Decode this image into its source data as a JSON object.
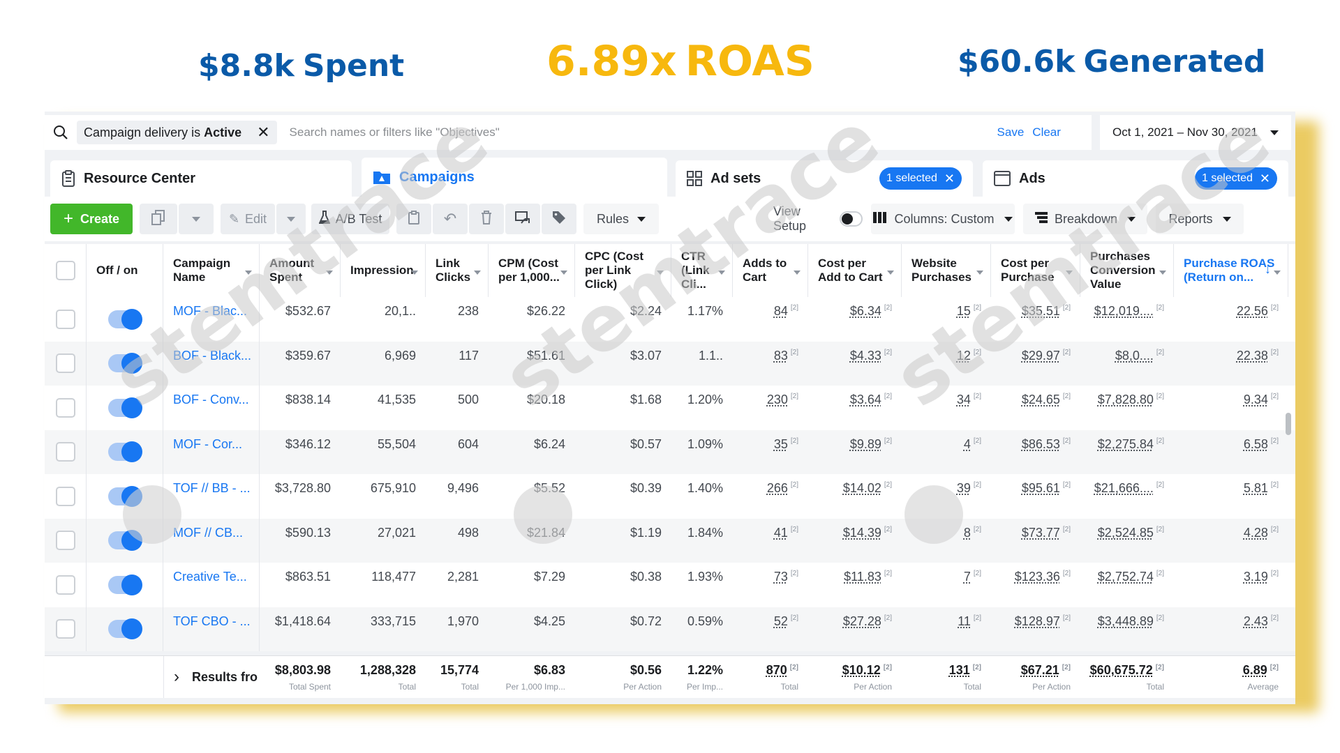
{
  "stats": {
    "spent_value": "$8.8k",
    "spent_label": "Spent",
    "roas_value": "6.89x",
    "roas_label": "ROAS",
    "generated_value": "$60.6k",
    "generated_label": "Generated"
  },
  "filter": {
    "chip_prefix": "Campaign delivery is",
    "chip_value": "Active",
    "placeholder": "Search names or filters like \"Objectives\"",
    "save": "Save",
    "clear": "Clear",
    "date_range": "Oct 1, 2021 – Nov 30, 2021"
  },
  "tabs": {
    "resource": "Resource Center",
    "campaigns": "Campaigns",
    "adsets": "Ad sets",
    "adsets_badge": "1 selected",
    "ads": "Ads",
    "ads_badge": "1 selected"
  },
  "toolbar": {
    "create": "Create",
    "edit": "Edit",
    "ab_test": "A/B Test",
    "rules": "Rules",
    "view_setup": "View Setup",
    "columns": "Columns: Custom",
    "breakdown": "Breakdown",
    "reports": "Reports"
  },
  "columns": [
    {
      "key": "toggle",
      "label": "Off / on"
    },
    {
      "key": "name",
      "label": "Campaign Name"
    },
    {
      "key": "spent",
      "label": "Amount Spent"
    },
    {
      "key": "impr",
      "label": "Impression"
    },
    {
      "key": "clicks",
      "label": "Link Clicks"
    },
    {
      "key": "cpm",
      "label": "CPM (Cost per 1,000..."
    },
    {
      "key": "cpc",
      "label": "CPC (Cost per Link Click)"
    },
    {
      "key": "ctr",
      "label": "CTR (Link Cli..."
    },
    {
      "key": "atc",
      "label": "Adds to Cart"
    },
    {
      "key": "cpatc",
      "label": "Cost per Add to Cart"
    },
    {
      "key": "wp",
      "label": "Website Purchases"
    },
    {
      "key": "cpp",
      "label": "Cost per Purchase"
    },
    {
      "key": "pcv",
      "label": "Purchases Conversion Value"
    },
    {
      "key": "roas",
      "label": "Purchase ROAS (Return on..."
    }
  ],
  "rows": [
    {
      "name": "MOF - Blac...",
      "spent": "$532.67",
      "impr": "20,1..",
      "clicks": "238",
      "cpm": "$26.22",
      "cpc": "$2.24",
      "ctr": "1.17%",
      "atc": "84",
      "cpatc": "$6.34",
      "wp": "15",
      "cpp": "$35.51",
      "pcv": "$12,019....",
      "roas": "22.56"
    },
    {
      "name": "BOF - Black...",
      "spent": "$359.67",
      "impr": "6,969",
      "clicks": "117",
      "cpm": "$51.61",
      "cpc": "$3.07",
      "ctr": "1.1..",
      "atc": "83",
      "cpatc": "$4.33",
      "wp": "12",
      "cpp": "$29.97",
      "pcv": "$8,0....",
      "roas": "22.38"
    },
    {
      "name": "BOF - Conv...",
      "spent": "$838.14",
      "impr": "41,535",
      "clicks": "500",
      "cpm": "$20.18",
      "cpc": "$1.68",
      "ctr": "1.20%",
      "atc": "230",
      "cpatc": "$3.64",
      "wp": "34",
      "cpp": "$24.65",
      "pcv": "$7,828.80",
      "roas": "9.34"
    },
    {
      "name": "MOF - Cor...",
      "spent": "$346.12",
      "impr": "55,504",
      "clicks": "604",
      "cpm": "$6.24",
      "cpc": "$0.57",
      "ctr": "1.09%",
      "atc": "35",
      "cpatc": "$9.89",
      "wp": "4",
      "cpp": "$86.53",
      "pcv": "$2,275.84",
      "roas": "6.58"
    },
    {
      "name": "TOF // BB - ...",
      "spent": "$3,728.80",
      "impr": "675,910",
      "clicks": "9,496",
      "cpm": "$5.52",
      "cpc": "$0.39",
      "ctr": "1.40%",
      "atc": "266",
      "cpatc": "$14.02",
      "wp": "39",
      "cpp": "$95.61",
      "pcv": "$21,666....",
      "roas": "5.81"
    },
    {
      "name": "MOF // CB...",
      "spent": "$590.13",
      "impr": "27,021",
      "clicks": "498",
      "cpm": "$21.84",
      "cpc": "$1.19",
      "ctr": "1.84%",
      "atc": "41",
      "cpatc": "$14.39",
      "wp": "8",
      "cpp": "$73.77",
      "pcv": "$2,524.85",
      "roas": "4.28"
    },
    {
      "name": "Creative Te...",
      "spent": "$863.51",
      "impr": "118,477",
      "clicks": "2,281",
      "cpm": "$7.29",
      "cpc": "$0.38",
      "ctr": "1.93%",
      "atc": "73",
      "cpatc": "$11.83",
      "wp": "7",
      "cpp": "$123.36",
      "pcv": "$2,752.74",
      "roas": "3.19"
    },
    {
      "name": "TOF CBO - ...",
      "spent": "$1,418.64",
      "impr": "333,715",
      "clicks": "1,970",
      "cpm": "$4.25",
      "cpc": "$0.72",
      "ctr": "0.59%",
      "atc": "52",
      "cpatc": "$27.28",
      "wp": "11",
      "cpp": "$128.97",
      "pcv": "$3,448.89",
      "roas": "2.43"
    }
  ],
  "totals": {
    "label": "Results fro",
    "spent": "$8,803.98",
    "spent_sub": "Total Spent",
    "impr": "1,288,328",
    "impr_sub": "Total",
    "clicks": "15,774",
    "clicks_sub": "Total",
    "cpm": "$6.83",
    "cpm_sub": "Per 1,000 Imp...",
    "cpc": "$0.56",
    "cpc_sub": "Per Action",
    "ctr": "1.22%",
    "ctr_sub": "Per Imp...",
    "atc": "870",
    "atc_sub": "Total",
    "cpatc": "$10.12",
    "cpatc_sub": "Per Action",
    "wp": "131",
    "wp_sub": "Total",
    "cpp": "$67.21",
    "cpp_sub": "Per Action",
    "pcv": "$60,675.72",
    "pcv_sub": "Total",
    "roas": "6.89",
    "roas_sub": "Average"
  },
  "footnote_mark": "[2]",
  "watermark": "stemtrace",
  "colors": {
    "accent": "#1877f2",
    "create": "#42b72a",
    "stat_blue": "#0a5aa8",
    "stat_gold": "#f7b80e"
  }
}
